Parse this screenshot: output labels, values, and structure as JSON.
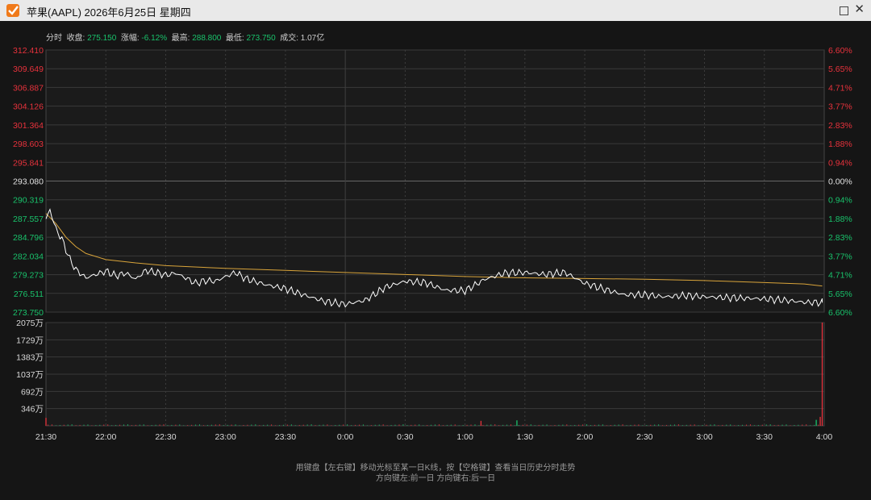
{
  "window": {
    "title": "苹果(AAPL) 2026年6月25日 星期四",
    "logo_icon": "checkmark-logo-icon"
  },
  "info": {
    "mode": "分时",
    "close_label": "收盘:",
    "close_value": "275.150",
    "change_label": "涨幅:",
    "change_value": "-6.12%",
    "high_label": "最高:",
    "high_value": "288.800",
    "low_label": "最低:",
    "low_value": "273.750",
    "volume_label": "成交:",
    "volume_value": "1.07亿"
  },
  "footer": {
    "line1": "用键盘【左右键】移动光标至某一日K线，按【空格键】查看当日历史分时走势",
    "line2": "方向键左:前一日    方向键右:后一日"
  },
  "colors": {
    "up": "#e8323c",
    "down": "#19c26b",
    "neutral": "#e0e0e0",
    "price_line": "#ffffff",
    "avg_line": "#d9a43a",
    "grid": "#3a3a3a"
  },
  "chart_data": {
    "type": "line",
    "prev_close": 293.08,
    "price_ticks_up": [
      "312.410",
      "309.649",
      "306.887",
      "304.126",
      "301.364",
      "298.603",
      "295.841"
    ],
    "price_tick_mid": "293.080",
    "price_ticks_down": [
      "290.319",
      "287.557",
      "284.796",
      "282.034",
      "279.273",
      "276.511",
      "273.750"
    ],
    "pct_ticks_up": [
      "6.60%",
      "5.65%",
      "4.71%",
      "3.77%",
      "2.83%",
      "1.88%",
      "0.94%"
    ],
    "pct_tick_mid": "0.00%",
    "pct_ticks_down": [
      "0.94%",
      "1.88%",
      "2.83%",
      "3.77%",
      "4.71%",
      "5.65%",
      "6.60%"
    ],
    "ylim": [
      273.75,
      312.41
    ],
    "x_ticks": [
      "21:30",
      "22:00",
      "22:30",
      "23:00",
      "23:30",
      "0:00",
      "0:30",
      "1:00",
      "1:30",
      "2:00",
      "2:30",
      "3:00",
      "3:30",
      "4:00"
    ],
    "price_series": {
      "minutes": [
        0,
        2,
        5,
        8,
        12,
        15,
        20,
        25,
        30,
        35,
        40,
        45,
        50,
        55,
        60,
        65,
        70,
        75,
        80,
        85,
        90,
        95,
        100,
        110,
        120,
        130,
        140,
        150,
        160,
        170,
        180,
        190,
        200,
        210,
        220,
        230,
        240,
        250,
        260,
        270,
        280,
        290,
        300,
        310,
        320,
        330,
        340,
        350,
        360,
        370,
        380,
        390,
        389
      ],
      "values": [
        287.5,
        288.8,
        286.0,
        284.5,
        281.5,
        280.0,
        278.8,
        279.3,
        279.8,
        279.1,
        279.5,
        278.6,
        279.9,
        279.6,
        279.2,
        279.5,
        278.8,
        278.0,
        278.4,
        278.3,
        279.0,
        279.6,
        278.7,
        277.8,
        277.2,
        276.2,
        275.3,
        274.9,
        275.5,
        277.4,
        278.3,
        278.1,
        277.0,
        276.9,
        278.6,
        279.5,
        279.6,
        279.3,
        279.6,
        278.0,
        277.1,
        276.3,
        276.3,
        276.0,
        276.2,
        276.0,
        275.9,
        275.8,
        275.7,
        275.5,
        275.2,
        275.15,
        275.15
      ],
      "note_values": []
    },
    "avg_series": {
      "minutes": [
        0,
        5,
        10,
        15,
        20,
        30,
        45,
        60,
        90,
        120,
        150,
        180,
        210,
        240,
        270,
        300,
        330,
        360,
        380,
        389
      ],
      "values": [
        288.3,
        286.8,
        284.8,
        283.4,
        282.4,
        281.5,
        281.0,
        280.6,
        280.2,
        279.9,
        279.6,
        279.3,
        279.0,
        278.8,
        278.7,
        278.6,
        278.4,
        278.1,
        277.9,
        277.6
      ]
    },
    "volume_ticks": [
      "2075万",
      "1729万",
      "1383万",
      "1037万",
      "692万",
      "346万"
    ],
    "volume_max": 2075,
    "volume_spikes": [
      {
        "minute": 389,
        "value": 2075,
        "dir": "up"
      },
      {
        "minute": 388,
        "value": 180,
        "dir": "up"
      },
      {
        "minute": 386,
        "value": 120,
        "dir": "down"
      },
      {
        "minute": 0,
        "value": 160,
        "dir": "up"
      },
      {
        "minute": 218,
        "value": 100,
        "dir": "up"
      },
      {
        "minute": 236,
        "value": 110,
        "dir": "down"
      }
    ]
  }
}
